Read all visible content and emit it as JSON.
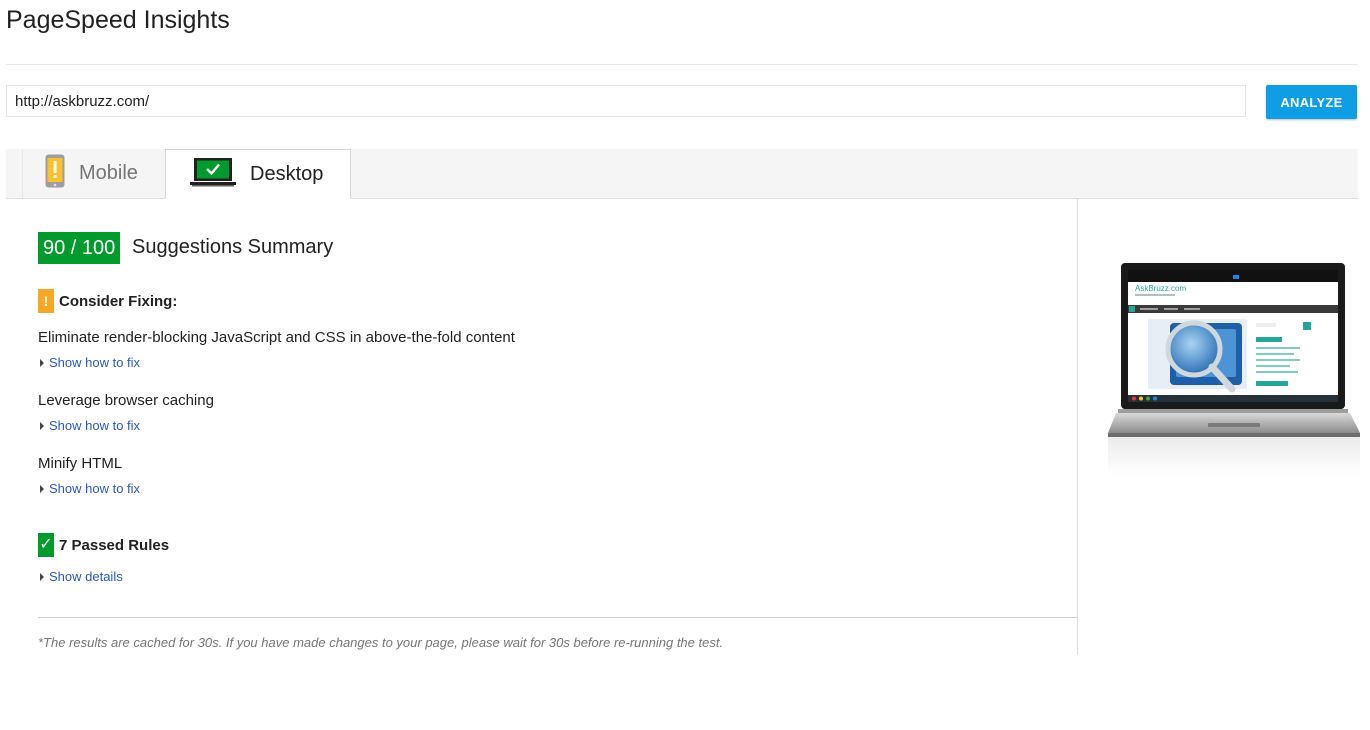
{
  "app": {
    "title": "PageSpeed Insights"
  },
  "search": {
    "url": "http://askbruzz.com/",
    "analyze_label": "ANALYZE"
  },
  "tabs": [
    {
      "label": "Mobile",
      "icon": "phone-icon",
      "active": false
    },
    {
      "label": "Desktop",
      "icon": "monitor-check-icon",
      "active": true
    }
  ],
  "summary": {
    "score": "90 / 100",
    "score_color": "#009a2d",
    "title": "Suggestions Summary"
  },
  "consider_fixing": {
    "icon_glyph": "!",
    "icon_color": "#f9a825",
    "heading": "Consider Fixing:",
    "rules": [
      {
        "title": "Eliminate render-blocking JavaScript and CSS in above-the-fold content",
        "link": "Show how to fix"
      },
      {
        "title": "Leverage browser caching",
        "link": "Show how to fix"
      },
      {
        "title": "Minify HTML",
        "link": "Show how to fix"
      }
    ]
  },
  "passed": {
    "icon_glyph": "✓",
    "heading": "7 Passed Rules",
    "link": "Show details"
  },
  "footer": {
    "note": "*The results are cached for 30s. If you have made changes to your page, please wait for 30s before re-running the test."
  },
  "preview": {
    "site_name": "AskBruzz.com",
    "accent": "#26a69a"
  }
}
